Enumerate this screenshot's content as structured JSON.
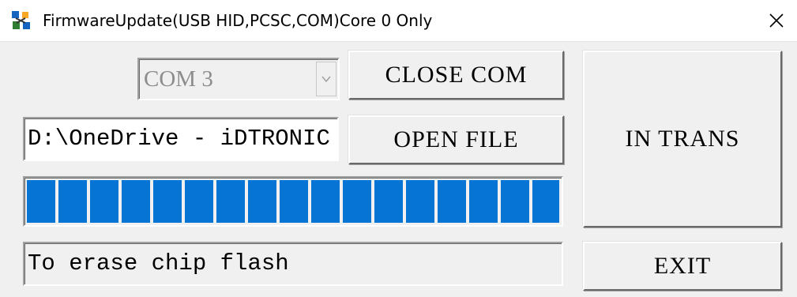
{
  "window": {
    "title": "FirmwareUpdate(USB HID,PCSC,COM)Core 0 Only",
    "app_icon": "app-icon",
    "close_icon": "close-icon"
  },
  "controls": {
    "com_port": {
      "selected": "COM 3",
      "enabled": false
    },
    "close_com_label": "CLOSE COM",
    "file_path": "D:\\OneDrive - iDTRONIC",
    "open_file_label": "OPEN FILE",
    "in_trans_label": "IN TRANS",
    "progress_fraction": 1.0,
    "status_text": "To erase chip flash",
    "exit_label": "EXIT"
  },
  "colors": {
    "progress_blue": "#0674d5",
    "face": "#f0f0f0"
  }
}
